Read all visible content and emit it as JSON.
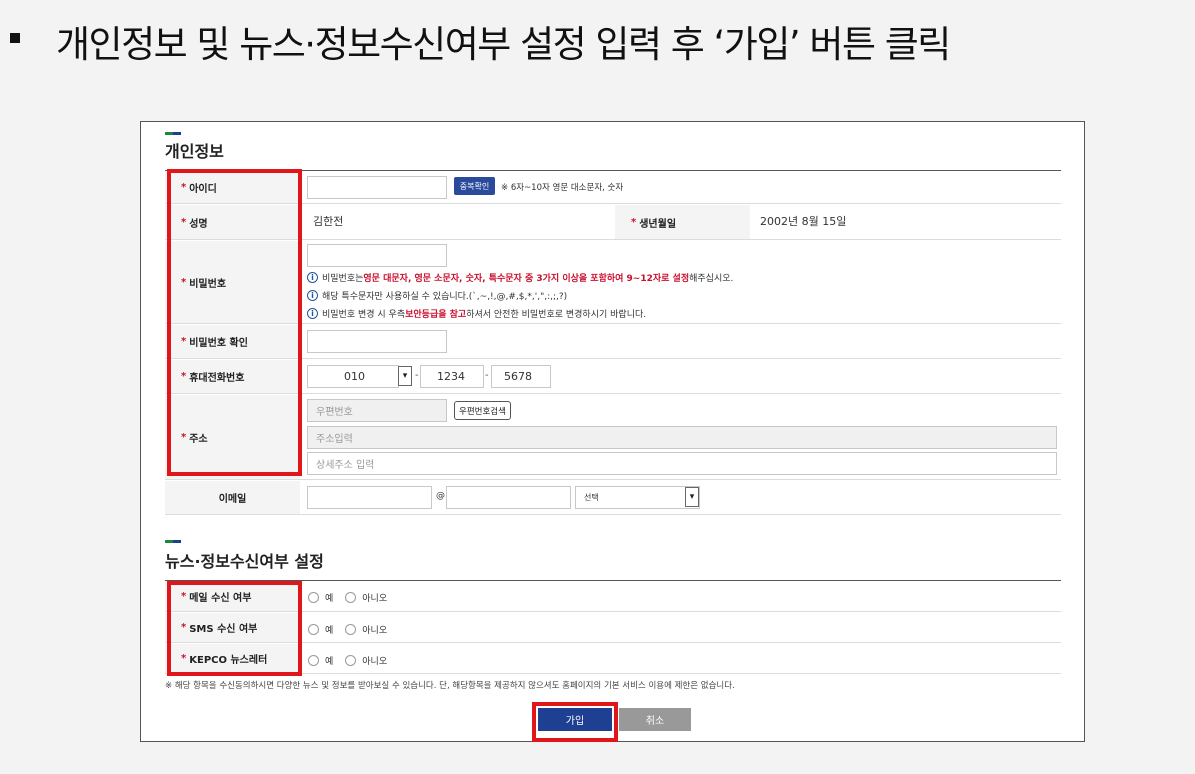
{
  "slide": {
    "title": "개인정보 및 뉴스·정보수신여부 설정 입력 후 ‘가입’ 버튼 클릭"
  },
  "personal": {
    "title": "개인정보",
    "id_label": "아이디",
    "dup_check": "중복확인",
    "id_hint": "※ 6자~10자 영문 대소문자, 숫자",
    "name_label": "성명",
    "name_value": "김한전",
    "birth_label": "생년월일",
    "birth_value": "2002년  8월  15일",
    "pw_label": "비밀번호",
    "pw_note1_a": "비밀번호는 ",
    "pw_note1_b": "영문 대문자, 영문 소문자, 숫자, 특수문자 중 3가지 이상을 포함하여 9~12자로 설정",
    "pw_note1_c": "해주십시오.",
    "pw_note2": "해당 특수문자만 사용하실 수 있습니다.(`,~,!,@,#,$,*,',\",:,;,?)",
    "pw_note3_a": "비밀번호 변경 시 우측 ",
    "pw_note3_b": "보안등급을 참고",
    "pw_note3_c": "하셔서 안전한 비밀번호로 변경하시기 바랍니다.",
    "pw_confirm_label": "비밀번호 확인",
    "phone_label": "휴대전화번호",
    "phone1": "010",
    "phone2": "1234",
    "phone3": "5678",
    "address_label": "주소",
    "zip_placeholder": "우편번호",
    "zip_button": "우편번호검색",
    "addr_placeholder": "주소입력",
    "addr_detail_placeholder": "상세주소 입력",
    "email_label": "이메일",
    "email_at": "@",
    "email_select": "선택"
  },
  "news": {
    "title": "뉴스·정보수신여부 설정",
    "rows": [
      {
        "label": "메일 수신 여부"
      },
      {
        "label": "SMS 수신 여부"
      },
      {
        "label": "KEPCO 뉴스레터"
      }
    ],
    "yes": "예",
    "no": "아니오",
    "footnote": "※ 해당 항목을 수신동의하시면 다양한 뉴스 및 정보를 받아보실 수 있습니다. 단, 해당항목을 제공하지 않으셔도 홈페이지의 기본 서비스 이용에 제한은 없습니다."
  },
  "buttons": {
    "join": "가입",
    "cancel": "취소"
  },
  "required_mark": "*",
  "colors": {
    "primary": "#1f3f92",
    "highlight": "#e0161b",
    "required": "#c8102e"
  }
}
